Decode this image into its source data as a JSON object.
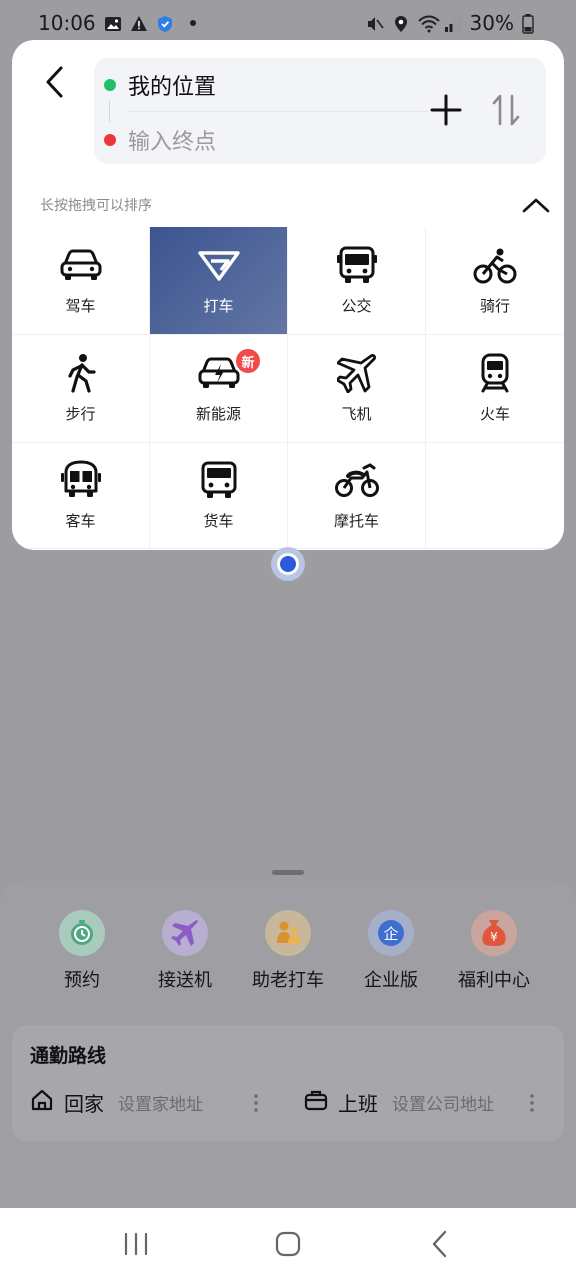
{
  "status_bar": {
    "time": "10:06",
    "battery": "30%"
  },
  "route": {
    "origin": "我的位置",
    "destination_placeholder": "输入终点"
  },
  "hint": "长按拖拽可以排序",
  "modes": [
    {
      "label": "驾车",
      "icon": "car-icon"
    },
    {
      "label": "打车",
      "icon": "taxi-icon",
      "active": true
    },
    {
      "label": "公交",
      "icon": "bus-icon"
    },
    {
      "label": "骑行",
      "icon": "bicycle-icon"
    },
    {
      "label": "步行",
      "icon": "walk-icon"
    },
    {
      "label": "新能源",
      "icon": "ev-car-icon",
      "badge": "新"
    },
    {
      "label": "飞机",
      "icon": "airplane-icon"
    },
    {
      "label": "火车",
      "icon": "train-icon"
    },
    {
      "label": "客车",
      "icon": "coach-icon"
    },
    {
      "label": "货车",
      "icon": "truck-icon"
    },
    {
      "label": "摩托车",
      "icon": "motorcycle-icon"
    }
  ],
  "shortcuts": [
    {
      "label": "预约",
      "icon": "clock-icon",
      "color": "#4fa882"
    },
    {
      "label": "接送机",
      "icon": "airplane-icon",
      "color": "#8b5cc4"
    },
    {
      "label": "助老打车",
      "icon": "elderly-icon",
      "color": "#d9922f"
    },
    {
      "label": "企业版",
      "icon": "enterprise-icon",
      "color": "#3d6fd0"
    },
    {
      "label": "福利中心",
      "icon": "money-bag-icon",
      "color": "#e0563c"
    }
  ],
  "commute": {
    "title": "通勤路线",
    "home_label": "回家",
    "home_hint": "设置家地址",
    "work_label": "上班",
    "work_hint": "设置公司地址"
  },
  "colors": {
    "accent_active": "#4a5f96",
    "origin_dot": "#1ec16a",
    "dest_dot": "#e8383b",
    "badge": "#f04a4a"
  }
}
